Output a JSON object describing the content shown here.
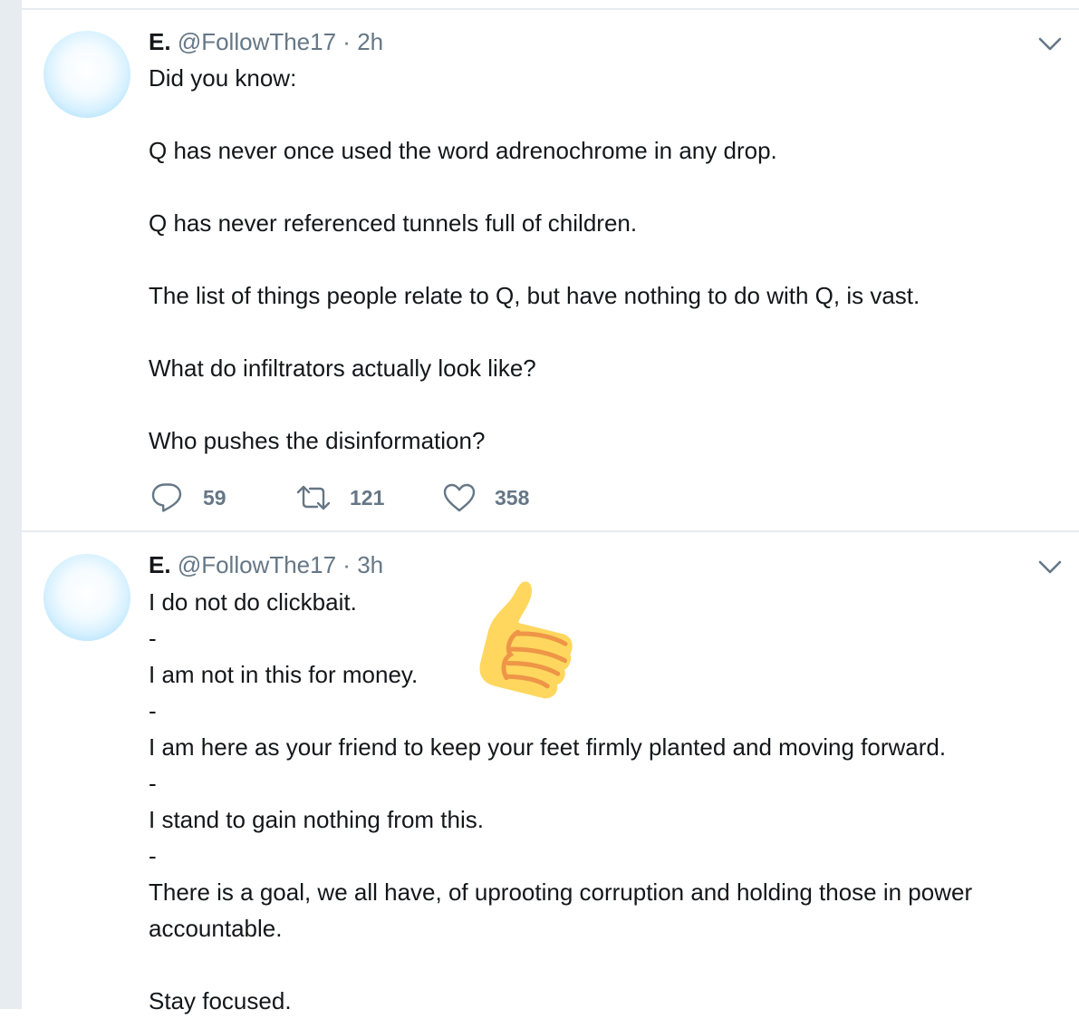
{
  "tweets": [
    {
      "name": "E.",
      "handle": "@FollowThe17",
      "separator": "·",
      "time": "2h",
      "text": "Did you know:\n\nQ has never once used the word adrenochrome in any drop.\n\nQ has never referenced tunnels full of children.\n\nThe list of things people relate to Q, but have nothing to do with Q, is vast.\n\nWhat do infiltrators actually look like?\n\nWho pushes the disinformation?",
      "replies": "59",
      "retweets": "121",
      "likes": "358"
    },
    {
      "name": "E.",
      "handle": "@FollowThe17",
      "separator": "·",
      "time": "3h",
      "text": "I do not do clickbait.\n-\nI am not in this for money.\n-\nI am here as your friend to keep your feet firmly planted and moving forward.\n-\nI stand to gain nothing from this.\n-\nThere is a goal, we all have, of uprooting corruption and holding those in power accountable.\n\nStay focused."
    }
  ],
  "colors": {
    "text": "#14171a",
    "secondary": "#657786",
    "divider": "#e6ecf0",
    "emoji_yellow": "#ffd75e",
    "emoji_orange": "#ee9547"
  },
  "icons": {
    "reply": "reply-icon",
    "retweet": "retweet-icon",
    "like": "heart-icon",
    "caret": "chevron-down-icon",
    "emoji": "thumbs-up-emoji"
  }
}
